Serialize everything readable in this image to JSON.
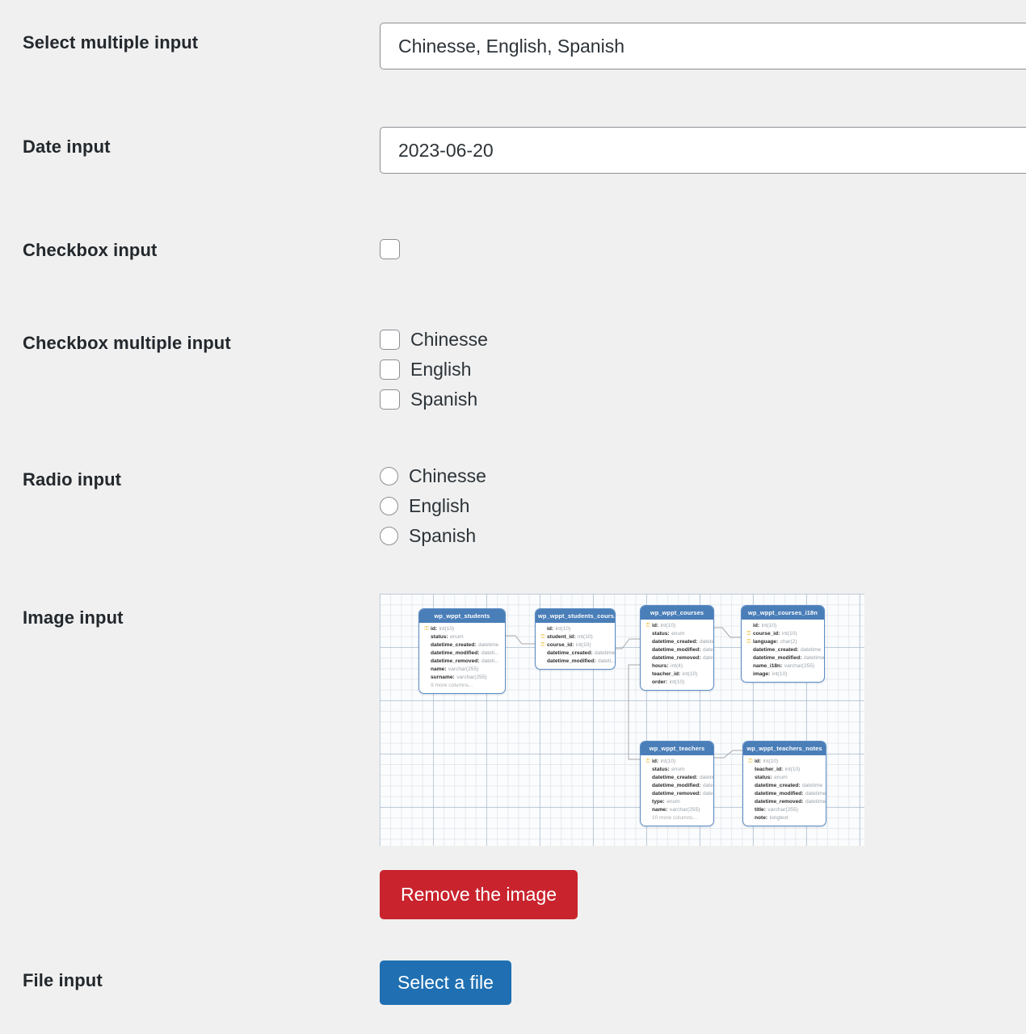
{
  "form": {
    "rows": [
      {
        "label": "Select multiple input",
        "type": "text",
        "value": "Chinesse, English, Spanish"
      },
      {
        "label": "Date input",
        "type": "text",
        "value": "2023-06-20"
      },
      {
        "label": "Checkbox input",
        "type": "checkbox"
      },
      {
        "label": "Checkbox multiple input",
        "type": "checkbox-group"
      },
      {
        "label": "Radio input",
        "type": "radio-group"
      },
      {
        "label": "Image input",
        "type": "image"
      },
      {
        "label": "File input",
        "type": "file"
      }
    ],
    "checkbox_options": [
      "Chinesse",
      "English",
      "Spanish"
    ],
    "radio_options": [
      "Chinesse",
      "English",
      "Spanish"
    ],
    "remove_image_label": "Remove the image",
    "select_file_label": "Select a file"
  },
  "colors": {
    "page_background": "#f0f0f0",
    "label_text": "#23282d",
    "input_border": "#8c8f94",
    "danger_button": "#c9232d",
    "primary_button": "#1f6fb2",
    "table_header": "#4a7eb8",
    "key_icon": "#e8b829"
  },
  "diagram": {
    "tables": [
      {
        "name": "wp_wppt_students",
        "columns": [
          {
            "key": true,
            "name": "id",
            "type": "int(10)"
          },
          {
            "key": false,
            "name": "status",
            "type": "enum"
          },
          {
            "key": false,
            "name": "datetime_created",
            "type": "datetime"
          },
          {
            "key": false,
            "name": "datetime_modified",
            "type": "dateti..."
          },
          {
            "key": false,
            "name": "datetime_removed",
            "type": "dateti..."
          },
          {
            "key": false,
            "name": "name",
            "type": "varchar(255)"
          },
          {
            "key": false,
            "name": "surname",
            "type": "varchar(255)"
          }
        ],
        "footer": "9 more columns..."
      },
      {
        "name": "wp_wppt_students_cours...",
        "columns": [
          {
            "key": false,
            "name": "id",
            "type": "int(10)"
          },
          {
            "key": true,
            "name": "student_id",
            "type": "int(10)"
          },
          {
            "key": true,
            "name": "course_id",
            "type": "int(10)"
          },
          {
            "key": false,
            "name": "datetime_created",
            "type": "datetime"
          },
          {
            "key": false,
            "name": "datetime_modified",
            "type": "dateti..."
          }
        ],
        "footer": ""
      },
      {
        "name": "wp_wppt_courses",
        "columns": [
          {
            "key": true,
            "name": "id",
            "type": "int(10)"
          },
          {
            "key": false,
            "name": "status",
            "type": "enum"
          },
          {
            "key": false,
            "name": "datetime_created",
            "type": "datetime"
          },
          {
            "key": false,
            "name": "datetime_modified",
            "type": "dateti..."
          },
          {
            "key": false,
            "name": "datetime_removed",
            "type": "dateti..."
          },
          {
            "key": false,
            "name": "hours",
            "type": "int(4)"
          },
          {
            "key": false,
            "name": "teacher_id",
            "type": "int(10)"
          },
          {
            "key": false,
            "name": "order",
            "type": "int(10)"
          }
        ],
        "footer": ""
      },
      {
        "name": "wp_wppt_courses_i18n",
        "columns": [
          {
            "key": false,
            "name": "id",
            "type": "int(10)"
          },
          {
            "key": true,
            "name": "course_id",
            "type": "int(10)"
          },
          {
            "key": true,
            "name": "language",
            "type": "char(2)"
          },
          {
            "key": false,
            "name": "datetime_created",
            "type": "datetime"
          },
          {
            "key": false,
            "name": "datetime_modified",
            "type": "datetime"
          },
          {
            "key": false,
            "name": "name_i18n",
            "type": "varchar(255)"
          },
          {
            "key": false,
            "name": "image",
            "type": "int(10)"
          }
        ],
        "footer": ""
      },
      {
        "name": "wp_wppt_teachers",
        "columns": [
          {
            "key": true,
            "name": "id",
            "type": "int(10)"
          },
          {
            "key": false,
            "name": "status",
            "type": "enum"
          },
          {
            "key": false,
            "name": "datetime_created",
            "type": "datetime"
          },
          {
            "key": false,
            "name": "datetime_modified",
            "type": "dateti..."
          },
          {
            "key": false,
            "name": "datetime_removed",
            "type": "dateti..."
          },
          {
            "key": false,
            "name": "type",
            "type": "enum"
          },
          {
            "key": false,
            "name": "name",
            "type": "varchar(255)"
          }
        ],
        "footer": "10 more columns..."
      },
      {
        "name": "wp_wppt_teachers_notes",
        "columns": [
          {
            "key": true,
            "name": "id",
            "type": "int(10)"
          },
          {
            "key": false,
            "name": "teacher_id",
            "type": "int(10)"
          },
          {
            "key": false,
            "name": "status",
            "type": "enum"
          },
          {
            "key": false,
            "name": "datetime_created",
            "type": "datetime"
          },
          {
            "key": false,
            "name": "datetime_modified",
            "type": "datetime"
          },
          {
            "key": false,
            "name": "datetime_removed",
            "type": "datetime"
          },
          {
            "key": false,
            "name": "title",
            "type": "varchar(255)"
          },
          {
            "key": false,
            "name": "note",
            "type": "longtext"
          }
        ],
        "footer": ""
      }
    ]
  }
}
